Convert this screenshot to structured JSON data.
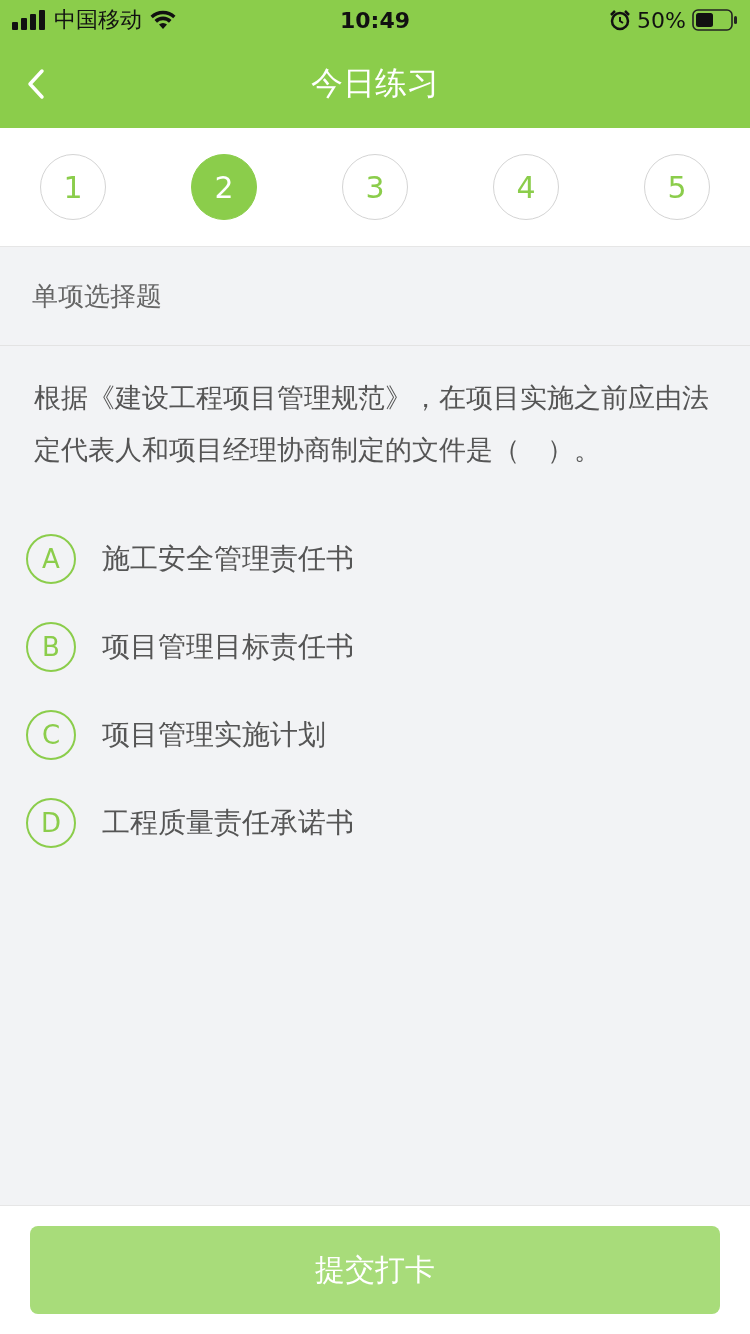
{
  "status_bar": {
    "carrier": "中国移动",
    "time": "10:49",
    "battery": "50%"
  },
  "nav": {
    "title": "今日练习"
  },
  "steps": [
    {
      "label": "1",
      "selected": false
    },
    {
      "label": "2",
      "selected": true
    },
    {
      "label": "3",
      "selected": false
    },
    {
      "label": "4",
      "selected": false
    },
    {
      "label": "5",
      "selected": false
    }
  ],
  "question": {
    "type_label": "单项选择题",
    "text": "根据《建设工程项目管理规范》，在项目实施之前应由法定代表人和项目经理协商制定的文件是（　）。",
    "options": [
      {
        "letter": "A",
        "text": "施工安全管理责任书",
        "selected": false
      },
      {
        "letter": "B",
        "text": "项目管理目标责任书",
        "selected": false
      },
      {
        "letter": "C",
        "text": "项目管理实施计划",
        "selected": false
      },
      {
        "letter": "D",
        "text": "工程质量责任承诺书",
        "selected": false
      }
    ]
  },
  "submit": {
    "label": "提交打卡",
    "disabled": true
  }
}
